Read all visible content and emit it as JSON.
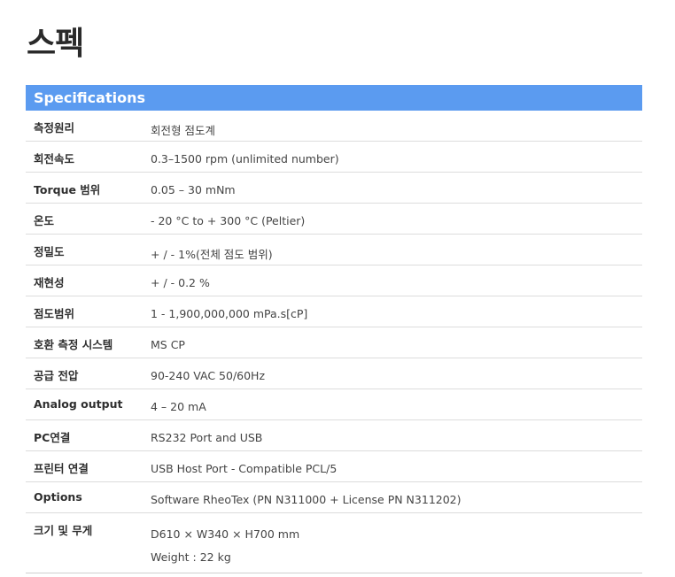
{
  "page": {
    "title": "스펙"
  },
  "table": {
    "header": "Specifications",
    "header_color": "#5b9bf0",
    "rows": [
      {
        "label": "측정원리",
        "value": "회전형 점도계"
      },
      {
        "label": "회전속도",
        "value": "0.3–1500 rpm (unlimited number)"
      },
      {
        "label": "Torque 범위",
        "value": "0.05 – 30 mNm"
      },
      {
        "label": "온도",
        "value": "- 20 °C to + 300 °C (Peltier)"
      },
      {
        "label": "정밀도",
        "value": "+ / - 1%(전체 점도 범위)"
      },
      {
        "label": "재현성",
        "value": "+ / - 0.2 %"
      },
      {
        "label": "점도범위",
        "value": " 1 - 1,900,000,000 mPa.s[cP]"
      },
      {
        "label": "호환 측정 시스템",
        "value": "MS CP"
      },
      {
        "label": "공급 전압",
        "value": "90-240 VAC 50/60Hz"
      },
      {
        "label": "Analog output",
        "value": "4 – 20 mA"
      },
      {
        "label": "PC연결",
        "value": "RS232 Port and USB"
      },
      {
        "label": "프린터 연결",
        "value": "USB Host Port - Compatible PCL/5"
      },
      {
        "label": "Options",
        "value": "Software RheoTex (PN N311000 + License PN N311202)"
      },
      {
        "label": "크기 및 무게",
        "value": "D610 × W340 × H700 mm",
        "value2": "Weight : 22 kg"
      }
    ]
  }
}
